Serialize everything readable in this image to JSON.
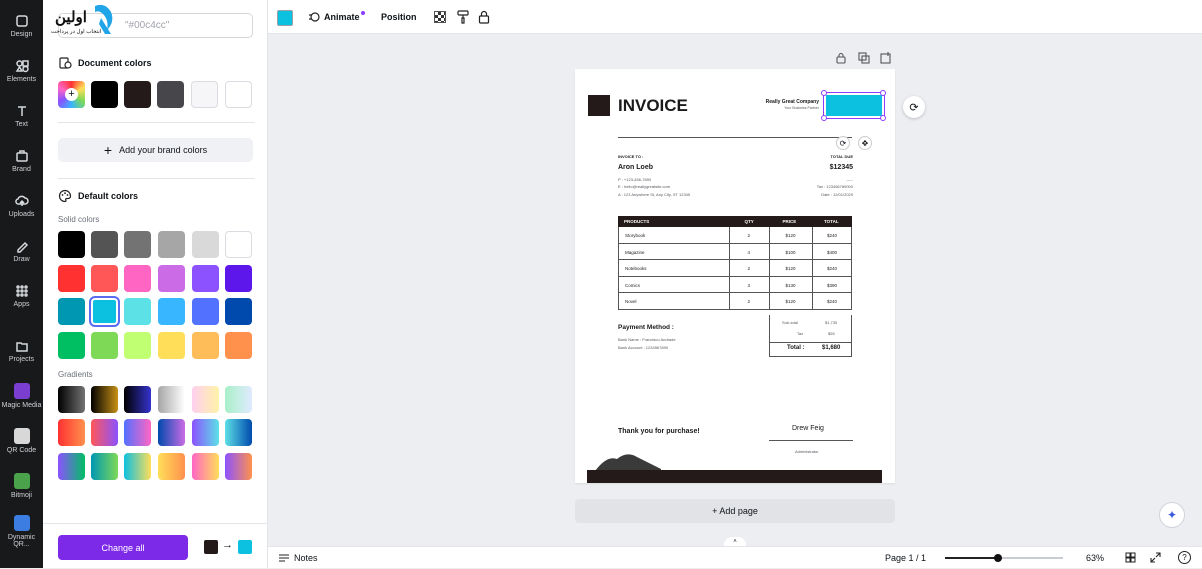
{
  "rail": {
    "items": [
      {
        "label": "Design"
      },
      {
        "label": "Elements"
      },
      {
        "label": "Text"
      },
      {
        "label": "Brand"
      },
      {
        "label": "Uploads"
      },
      {
        "label": "Draw"
      },
      {
        "label": "Apps"
      },
      {
        "label": "Projects"
      },
      {
        "label": "Magic Media"
      },
      {
        "label": "QR Code"
      },
      {
        "label": "Bitmoji"
      },
      {
        "label": "Dynamic QR..."
      }
    ]
  },
  "panel": {
    "search_value": "\"#00c4cc\"",
    "logo_text": "اولین",
    "logo_sub": "انتخاب اول در پرداخت",
    "document_colors_title": "Document colors",
    "document_colors": [
      "#000000",
      "#231a19",
      "#47464a",
      "#f6f6f8",
      "#ffffff"
    ],
    "add_brand_label": "Add your brand colors",
    "default_colors_title": "Default colors",
    "solid_colors_title": "Solid colors",
    "solid_colors": [
      [
        "#000000",
        "#545454",
        "#737373",
        "#a6a6a6",
        "#d9d9d9",
        "#ffffff"
      ],
      [
        "#ff3131",
        "#ff5757",
        "#ff66c4",
        "#cb6ce6",
        "#8c52ff",
        "#5e17eb"
      ],
      [
        "#0097b2",
        "#0cc0df",
        "#5ce1e6",
        "#38b6ff",
        "#5271ff",
        "#004aad"
      ],
      [
        "#00bf63",
        "#7ed957",
        "#c1ff72",
        "#ffde59",
        "#ffbd59",
        "#ff914d"
      ]
    ],
    "selected_color": "#0cc0df",
    "gradients_title": "Gradients",
    "gradients": [
      [
        "linear-gradient(90deg,#000,#737373)",
        "linear-gradient(90deg,#000,#c89116)",
        "linear-gradient(90deg,#000,#3533cd)",
        "linear-gradient(90deg,#a6a6a6,#fff)",
        "linear-gradient(90deg,#ffd0f0,#fff2a8)",
        "linear-gradient(90deg,#a8f0c8,#e0eaff)"
      ],
      [
        "linear-gradient(90deg,#ff3131,#ff914d)",
        "linear-gradient(90deg,#ff5757,#8c52ff)",
        "linear-gradient(90deg,#5170ff,#ff66c4)",
        "linear-gradient(90deg,#004aad,#cb6ce6)",
        "linear-gradient(90deg,#8c52ff,#5ce1e6)",
        "linear-gradient(90deg,#5de0e6,#004aad)"
      ],
      [
        "linear-gradient(90deg,#8c52ff,#00bf63)",
        "linear-gradient(90deg,#0097b2,#7ed957)",
        "linear-gradient(90deg,#0cc0df,#ffde59)",
        "linear-gradient(90deg,#ffde59,#ff914d)",
        "linear-gradient(90deg,#ff66c4,#ffde59)",
        "linear-gradient(90deg,#8c52ff,#ff914d)"
      ]
    ],
    "change_all_label": "Change all",
    "change_from": "#231a19",
    "change_to": "#0cc0df"
  },
  "toolbar": {
    "current_color": "#0cc0df",
    "animate_label": "Animate",
    "position_label": "Position"
  },
  "invoice": {
    "title": "INVOICE",
    "company": "Really Great Company",
    "company_sub": "Your Business Partner",
    "invoice_to_label": "INVOICE TO :",
    "client_name": "Aron Loeb",
    "client_phone": "P : +123-456-7890",
    "client_email": "E : hello@reallygreatsite.com",
    "client_address": "A : 123 Anywhere St, Any City, ST 12345",
    "total_due_label": "TOTAL DUE",
    "total_due_value": "$12345",
    "dash": "-----",
    "tax_no": "Tax : 123456789000",
    "date": "Date : 12/01/2029",
    "headers": [
      "PRODUCTS",
      "QTY",
      "PRICE",
      "TOTAL"
    ],
    "rows": [
      [
        "Storybook",
        "2",
        "$120",
        "$240"
      ],
      [
        "Magazine",
        "4",
        "$100",
        "$400"
      ],
      [
        "Notebooks",
        "2",
        "$120",
        "$240"
      ],
      [
        "Comics",
        "3",
        "$130",
        "$390"
      ],
      [
        "Novel",
        "2",
        "$120",
        "$240"
      ]
    ],
    "payment_title": "Payment Method :",
    "bank_name": "Bank Name : Francisco Andrade",
    "bank_account": "Bank Account : 1234567890",
    "subtotal_label": "Sub-total",
    "subtotal_value": "$1,735",
    "tax_label": "Tax",
    "tax_value": "$55",
    "total_label": "Total :",
    "total_value": "$1,680",
    "thanks": "Thank you for purchase!",
    "signer": "Drew Feig",
    "signer_role": "Administrator",
    "accent": "#231a19",
    "selected_box_color": "#0cc0df"
  },
  "canvas": {
    "add_page_label": "+ Add page"
  },
  "bottombar": {
    "notes_label": "Notes",
    "page_label": "Page 1 / 1",
    "zoom": "63%",
    "zoom_level": 0.45
  }
}
